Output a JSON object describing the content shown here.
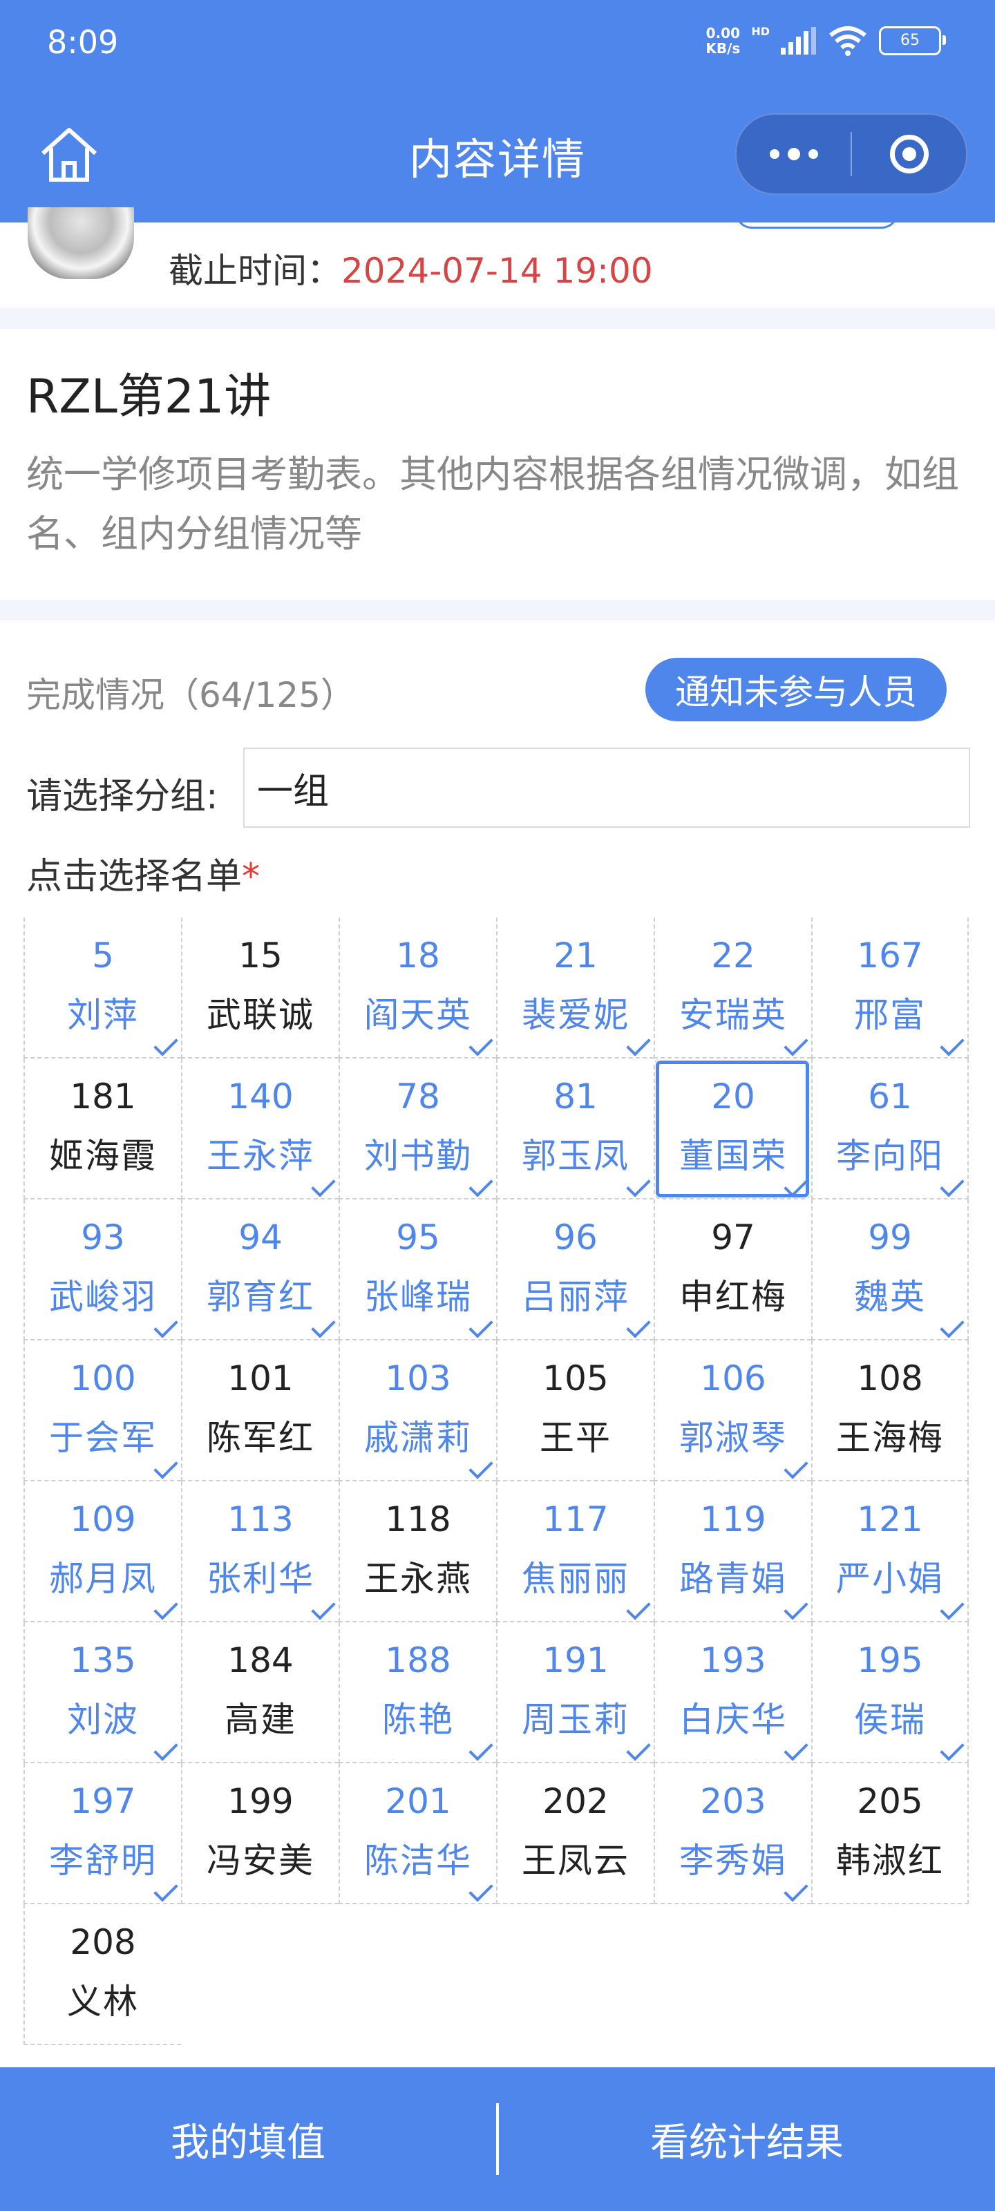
{
  "status_bar": {
    "time": "8:09",
    "net_speed_top": "0.00",
    "net_speed_bottom": "KB/s",
    "hd": "HD",
    "battery": "65"
  },
  "header": {
    "title": "内容详情",
    "home_icon": "home-icon",
    "more_icon": "more-icon",
    "close_icon": "target-icon"
  },
  "info": {
    "deadline_label": "截止时间：",
    "deadline_value": "2024-07-14 19:00"
  },
  "lecture": {
    "title": "RZL第21讲",
    "description": "统一学修项目考勤表。其他内容根据各组情况微调，如组名、组内分组情况等"
  },
  "progress": {
    "text": "完成情况（64/125）",
    "notify_button": "通知未参与人员"
  },
  "group": {
    "label": "请选择分组:",
    "value": "一组"
  },
  "list": {
    "label": "点击选择名单",
    "required_mark": "*",
    "members": [
      {
        "num": "5",
        "name": "刘萍",
        "selected": true
      },
      {
        "num": "15",
        "name": "武联诚",
        "selected": false
      },
      {
        "num": "18",
        "name": "阎天英",
        "selected": true
      },
      {
        "num": "21",
        "name": "裴爱妮",
        "selected": true
      },
      {
        "num": "22",
        "name": "安瑞英",
        "selected": true
      },
      {
        "num": "167",
        "name": "邢富",
        "selected": true
      },
      {
        "num": "181",
        "name": "姬海霞",
        "selected": false
      },
      {
        "num": "140",
        "name": "王永萍",
        "selected": true
      },
      {
        "num": "78",
        "name": "刘书勤",
        "selected": true
      },
      {
        "num": "81",
        "name": "郭玉凤",
        "selected": true
      },
      {
        "num": "20",
        "name": "董国荣",
        "selected": true,
        "focused": true
      },
      {
        "num": "61",
        "name": "李向阳",
        "selected": true
      },
      {
        "num": "93",
        "name": "武峻羽",
        "selected": true
      },
      {
        "num": "94",
        "name": "郭育红",
        "selected": true
      },
      {
        "num": "95",
        "name": "张峰瑞",
        "selected": true
      },
      {
        "num": "96",
        "name": "吕丽萍",
        "selected": true
      },
      {
        "num": "97",
        "name": "申红梅",
        "selected": false
      },
      {
        "num": "99",
        "name": "魏英",
        "selected": true
      },
      {
        "num": "100",
        "name": "于会军",
        "selected": true
      },
      {
        "num": "101",
        "name": "陈军红",
        "selected": false
      },
      {
        "num": "103",
        "name": "戚潇莉",
        "selected": true
      },
      {
        "num": "105",
        "name": "王平",
        "selected": false
      },
      {
        "num": "106",
        "name": "郭淑琴",
        "selected": true
      },
      {
        "num": "108",
        "name": "王海梅",
        "selected": false
      },
      {
        "num": "109",
        "name": "郝月凤",
        "selected": true
      },
      {
        "num": "113",
        "name": "张利华",
        "selected": true
      },
      {
        "num": "118",
        "name": "王永燕",
        "selected": false
      },
      {
        "num": "117",
        "name": "焦丽丽",
        "selected": true
      },
      {
        "num": "119",
        "name": "路青娟",
        "selected": true
      },
      {
        "num": "121",
        "name": "严小娟",
        "selected": true
      },
      {
        "num": "135",
        "name": "刘波",
        "selected": true
      },
      {
        "num": "184",
        "name": "高建",
        "selected": false
      },
      {
        "num": "188",
        "name": "陈艳",
        "selected": true
      },
      {
        "num": "191",
        "name": "周玉莉",
        "selected": true
      },
      {
        "num": "193",
        "name": "白庆华",
        "selected": true
      },
      {
        "num": "195",
        "name": "侯瑞",
        "selected": true
      },
      {
        "num": "197",
        "name": "李舒明",
        "selected": true
      },
      {
        "num": "199",
        "name": "冯安美",
        "selected": false
      },
      {
        "num": "201",
        "name": "陈洁华",
        "selected": true
      },
      {
        "num": "202",
        "name": "王凤云",
        "selected": false
      },
      {
        "num": "203",
        "name": "李秀娟",
        "selected": true
      },
      {
        "num": "205",
        "name": "韩淑红",
        "selected": false
      },
      {
        "num": "208",
        "name": "义林",
        "selected": false
      }
    ]
  },
  "bottom": {
    "my_values": "我的填值",
    "view_stats": "看统计结果"
  },
  "colors": {
    "primary": "#4f86ec",
    "deadline": "#d64545",
    "required": "#e53935"
  }
}
